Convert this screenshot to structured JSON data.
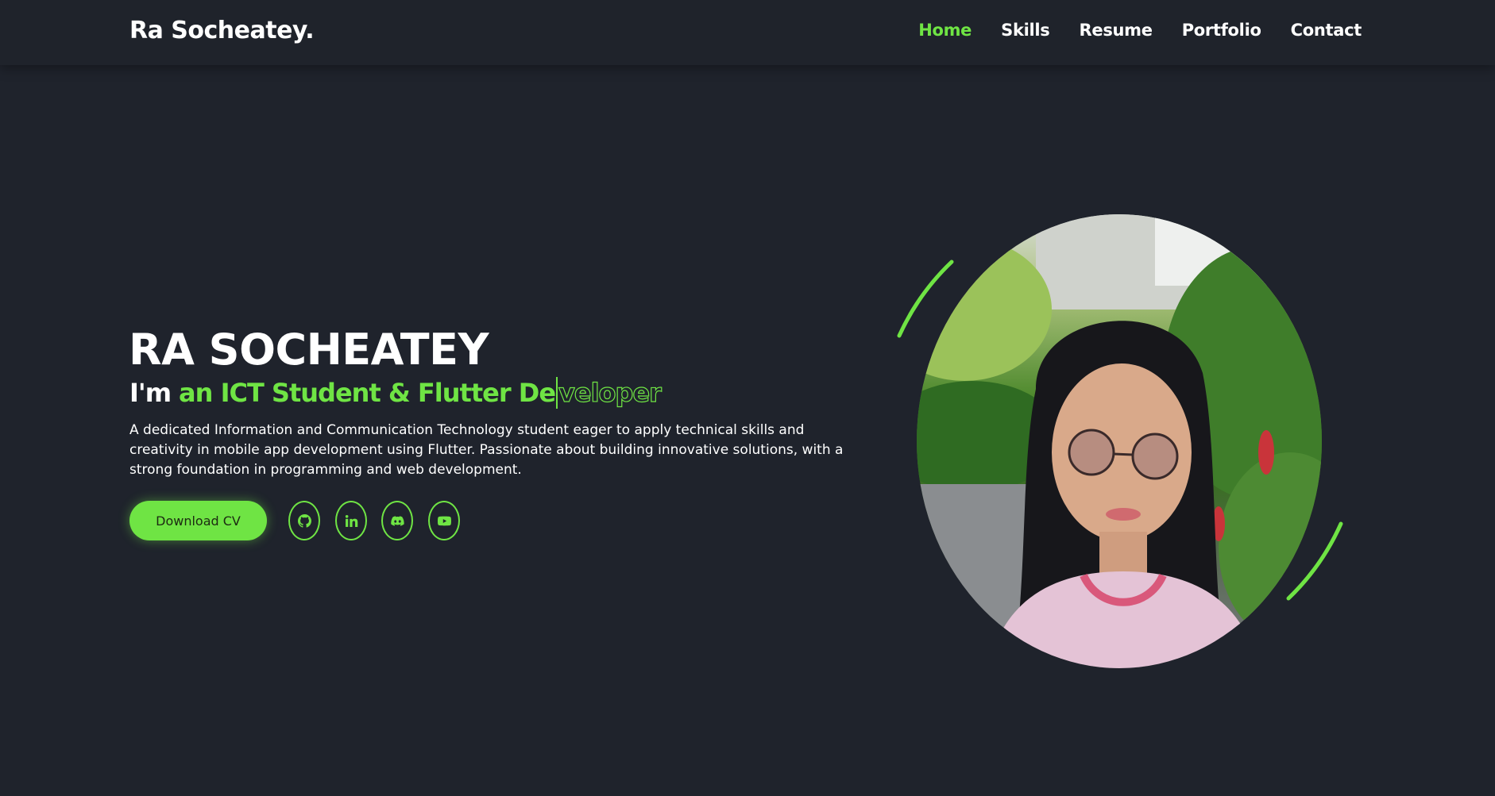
{
  "header": {
    "brand": "Ra Socheatey.",
    "nav": [
      {
        "label": "Home",
        "active": true
      },
      {
        "label": "Skills",
        "active": false
      },
      {
        "label": "Resume",
        "active": false
      },
      {
        "label": "Portfolio",
        "active": false
      },
      {
        "label": "Contact",
        "active": false
      }
    ]
  },
  "hero": {
    "name": "RA SOCHEATEY",
    "role_prefix": "I'm",
    "role_typed": "an ICT Student & Flutter De",
    "role_rest": "veloper",
    "description": "A dedicated Information and Communication Technology student eager to apply technical skills and creativity in mobile app development using Flutter. Passionate about building innovative solutions, with a strong foundation in programming and web development.",
    "cv_button": "Download CV",
    "socials": [
      "github-icon",
      "linkedin-icon",
      "discord-icon",
      "youtube-icon"
    ]
  },
  "colors": {
    "accent": "#6fe444",
    "background": "#1f232c",
    "header_background": "#1f232b",
    "text": "#ffffff"
  }
}
